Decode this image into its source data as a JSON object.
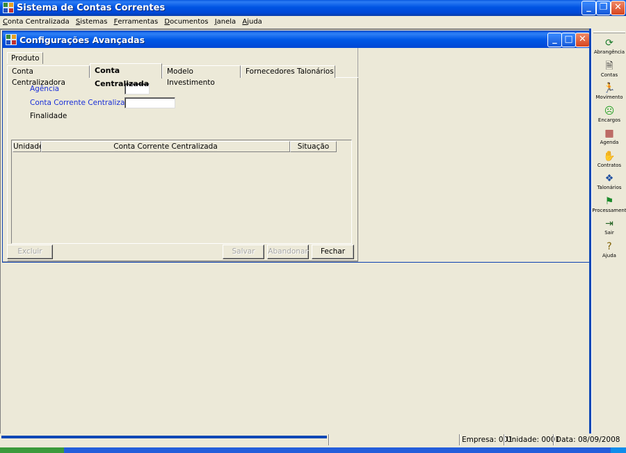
{
  "app": {
    "title": "Sistema de Contas Correntes",
    "menu": [
      {
        "label": "Conta Centralizada",
        "mnemonic": "C"
      },
      {
        "label": "Sistemas",
        "mnemonic": "S"
      },
      {
        "label": "Ferramentas",
        "mnemonic": "F"
      },
      {
        "label": "Documentos",
        "mnemonic": "D"
      },
      {
        "label": "Janela",
        "mnemonic": "J"
      },
      {
        "label": "Ajuda",
        "mnemonic": "A"
      }
    ]
  },
  "window": {
    "title": "Configurações Avançadas",
    "tabs_top": [
      "Produto"
    ],
    "tabs": [
      {
        "label": "Conta Centralizadora",
        "active": false
      },
      {
        "label": "Conta Centralizada",
        "active": true
      },
      {
        "label": "Modelo Investimento",
        "active": false
      },
      {
        "label": "Fornecedores Talonários",
        "active": false
      }
    ],
    "form": {
      "agencia_label": "Agência",
      "agencia_value": "",
      "conta_corrente_label": "Conta Corrente Centralizadora",
      "conta_corrente_value": "",
      "finalidade_label": "Finalidade"
    },
    "grid": {
      "columns": [
        "Unidade",
        "Conta Corrente Centralizada",
        "Situação"
      ],
      "rows": []
    },
    "buttons": {
      "excluir": "Excluir",
      "salvar": "Salvar",
      "abandonar": "Abandonar",
      "fechar": "Fechar"
    }
  },
  "toolbar": {
    "items": [
      {
        "label": "Abrangência",
        "icon": "globe-icon",
        "glyph": "⟳",
        "color": "#1a7a2a"
      },
      {
        "label": "Contas",
        "icon": "ledger-icon",
        "glyph": "🗎",
        "color": "#333"
      },
      {
        "label": "Movimento",
        "icon": "running-man-icon",
        "glyph": "🏃",
        "color": "#1a2fd8"
      },
      {
        "label": "Encargos",
        "icon": "sad-face-icon",
        "glyph": "☹",
        "color": "#22a022"
      },
      {
        "label": "Agenda",
        "icon": "calendar-icon",
        "glyph": "▦",
        "color": "#a02020"
      },
      {
        "label": "Contratos",
        "icon": "handshake-icon",
        "glyph": "✋",
        "color": "#806020"
      },
      {
        "label": "Talonários",
        "icon": "checkbook-icon",
        "glyph": "❖",
        "color": "#2050a0"
      },
      {
        "label": "Processament",
        "icon": "flag-icon",
        "glyph": "⚑",
        "color": "#1a8a2a"
      },
      {
        "label": "Sair",
        "icon": "exit-door-icon",
        "glyph": "⇥",
        "color": "#206020"
      },
      {
        "label": "Ajuda",
        "icon": "question-icon",
        "glyph": "?",
        "color": "#806000"
      }
    ]
  },
  "status": {
    "empresa": "Empresa: 001",
    "unidade": "Unidade: 0001",
    "data": "Data:  08/09/2008"
  },
  "colors": {
    "title_blue": "#0054e3",
    "form_label_blue": "#1a2fd8",
    "face": "#ece9d8"
  }
}
